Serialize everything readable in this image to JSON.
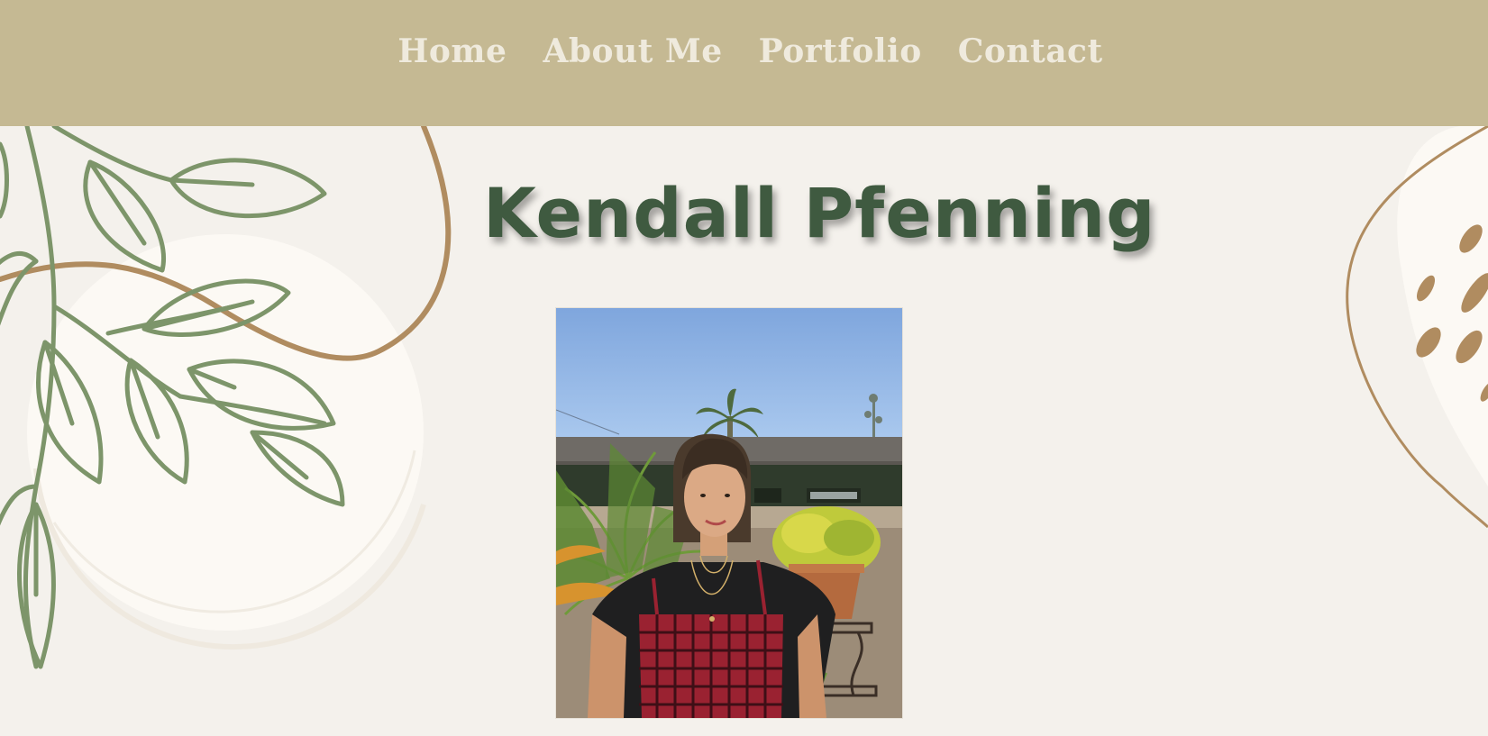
{
  "nav": {
    "items": [
      {
        "label": "Home"
      },
      {
        "label": "About Me"
      },
      {
        "label": "Portfolio"
      },
      {
        "label": "Contact"
      }
    ]
  },
  "hero": {
    "title": "Kendall Pfenning"
  },
  "colors": {
    "navbar_bg": "#c5b993",
    "nav_text": "#efeadd",
    "page_bg": "#f4f1ec",
    "title_color": "#3f5a40",
    "leaf_green": "#7d956a",
    "accent_brown": "#b08c60"
  },
  "icons": [
    "leaf-branch-decoration",
    "circle-stroke-decoration",
    "dots-decoration"
  ]
}
